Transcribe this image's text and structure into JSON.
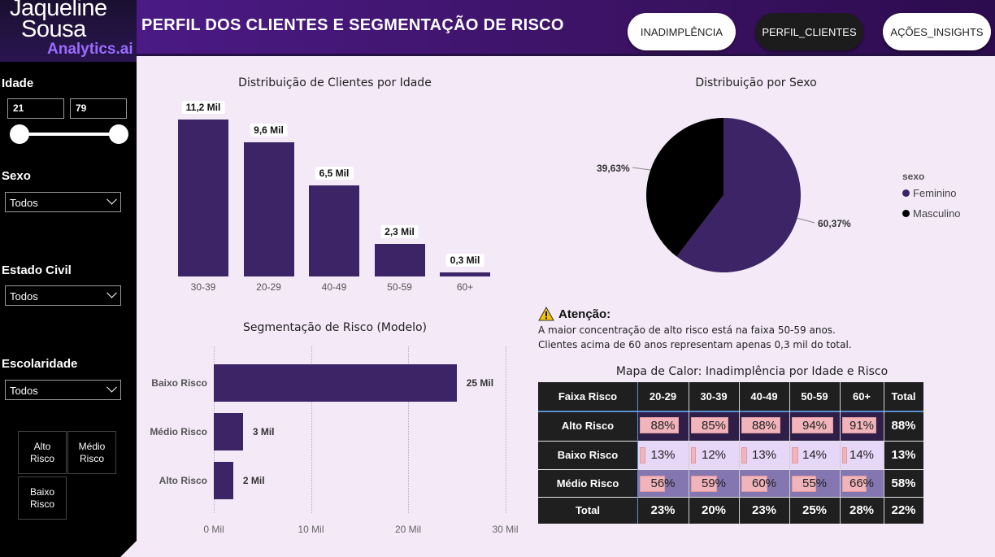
{
  "brand": {
    "line1": "Jaqueline",
    "line2": "Sousa",
    "line3": "Analytics.ai"
  },
  "header": {
    "title": "PERFIL DOS CLIENTES E SEGMENTAÇÃO DE RISCO",
    "nav": [
      {
        "label": "INADIMPLÊNCIA",
        "active": false
      },
      {
        "label": "PERFIL_CLIENTES",
        "active": true
      },
      {
        "label": "AÇÕES_INSIGHTS",
        "active": false
      }
    ]
  },
  "filters": {
    "age_label": "Idade",
    "age_min": "21",
    "age_max": "79",
    "sex_label": "Sexo",
    "sex_value": "Todos",
    "civil_label": "Estado Civil",
    "civil_value": "Todos",
    "edu_label": "Escolaridade",
    "edu_value": "Todos",
    "risk_buttons": [
      {
        "label": "Alto Risco"
      },
      {
        "label": "Médio Risco"
      },
      {
        "label": "Baixo Risco"
      }
    ]
  },
  "chart_data": [
    {
      "type": "bar",
      "title": "Distribuição de Clientes por Idade",
      "categories": [
        "30-39",
        "20-29",
        "40-49",
        "50-59",
        "60+"
      ],
      "values": [
        11.2,
        9.6,
        6.5,
        2.3,
        0.3
      ],
      "data_labels": [
        "11,2 Mil",
        "9,6 Mil",
        "6,5 Mil",
        "2,3 Mil",
        "0,3 Mil"
      ],
      "color": "#3d2466"
    },
    {
      "type": "pie",
      "title": "Distribuição por Sexo",
      "legend_title": "sexo",
      "legend_position": "right",
      "series": [
        {
          "name": "Feminino",
          "value": 60.37,
          "label": "60,37%",
          "color": "#3d2466"
        },
        {
          "name": "Masculino",
          "value": 39.63,
          "label": "39,63%",
          "color": "#000000"
        }
      ]
    },
    {
      "type": "bar",
      "orientation": "horizontal",
      "title": "Segmentação de Risco (Modelo)",
      "categories": [
        "Baixo Risco",
        "Médio Risco",
        "Alto Risco"
      ],
      "values": [
        25,
        3,
        2
      ],
      "data_labels": [
        "25 Mil",
        "3 Mil",
        "2 Mil"
      ],
      "xlim": [
        0,
        30
      ],
      "x_ticks": [
        "0 Mil",
        "10 Mil",
        "20 Mil",
        "30 Mil"
      ],
      "grid": true,
      "color": "#3d2466"
    },
    {
      "type": "heatmap",
      "title": "Mapa de Calor: Inadimplência por Idade e Risco",
      "corner": "Faixa Risco",
      "columns": [
        "20-29",
        "30-39",
        "40-49",
        "50-59",
        "60+",
        "Total"
      ],
      "rows": [
        {
          "name": "Alto Risco",
          "values": [
            "88%",
            "85%",
            "88%",
            "94%",
            "91%"
          ],
          "fill": [
            0.88,
            0.85,
            0.88,
            0.94,
            0.91
          ],
          "bg": "#2f1f48",
          "total": "88%"
        },
        {
          "name": "Baixo Risco",
          "values": [
            "13%",
            "12%",
            "13%",
            "14%",
            "14%"
          ],
          "fill": [
            0.13,
            0.12,
            0.13,
            0.14,
            0.14
          ],
          "bg": "#e6d6f7",
          "total": "13%"
        },
        {
          "name": "Médio Risco",
          "values": [
            "56%",
            "59%",
            "60%",
            "55%",
            "66%"
          ],
          "fill": [
            0.56,
            0.59,
            0.6,
            0.55,
            0.66
          ],
          "bg": "#8476b0",
          "total": "58%"
        }
      ],
      "total_row": {
        "name": "Total",
        "values": [
          "23%",
          "20%",
          "23%",
          "25%",
          "28%"
        ],
        "total": "22%"
      }
    }
  ],
  "attention": {
    "title": "Atenção:",
    "lines": [
      "A maior concentração de alto risco está na faixa 50-59 anos.",
      "Clientes acima de 60 anos representam apenas 0,3 mil do total."
    ]
  }
}
